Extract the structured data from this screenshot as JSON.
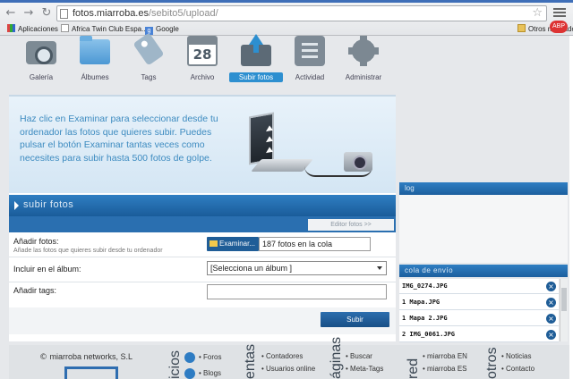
{
  "browser": {
    "url_host": "fotos.miarroba.es",
    "url_path": "/sebito5/upload/",
    "bookmarks": [
      "Aplicaciones",
      "Africa Twin Club Espa...",
      "Google"
    ],
    "other_bookmarks": "Otros marcadores",
    "badge": "ABP"
  },
  "nav": {
    "items": [
      {
        "label": "Galería",
        "icon": "camera-icon"
      },
      {
        "label": "Álbumes",
        "icon": "folder-icon"
      },
      {
        "label": "Tags",
        "icon": "tag-icon"
      },
      {
        "label": "Archivo",
        "icon": "calendar-icon",
        "number": "28"
      },
      {
        "label": "Subir fotos",
        "icon": "upload-icon",
        "active": true
      },
      {
        "label": "Actividad",
        "icon": "activity-icon"
      },
      {
        "label": "Administrar",
        "icon": "gear-icon"
      }
    ]
  },
  "hero": {
    "text": "Haz clic en Examinar para seleccionar desde tu ordenador las fotos que quieres subir. Puedes pulsar el botón Examinar tantas veces como necesites para subir hasta 500 fotos de golpe."
  },
  "upload": {
    "title": "subir fotos",
    "editor_link": "Editor fotos >>",
    "add_photos_label": "Añadir fotos:",
    "add_photos_hint": "Añade las fotos que quieres subir desde tu ordenador",
    "browse_button": "Examinar...",
    "queue_count": "187 fotos en la cola",
    "album_label": "Incluir en el álbum:",
    "album_select": "[Selecciona un álbum ]",
    "tags_label": "Añadir tags:",
    "tags_value": "",
    "submit": "Subir"
  },
  "log": {
    "title": "log"
  },
  "queue": {
    "title": "cola de envío",
    "items": [
      {
        "name": "IMG_0274.JPG"
      },
      {
        "name": "1 Mapa.JPG"
      },
      {
        "name": "1 Mapa 2.JPG"
      },
      {
        "name": "2 IMG_0061.JPG"
      }
    ]
  },
  "footer": {
    "brand": "miarroba networks, S.L",
    "copyright": "©",
    "sections": [
      "icios",
      "entas",
      "áginas",
      "red",
      "otros"
    ],
    "links": {
      "col1": [
        "Foros",
        "Blogs"
      ],
      "col2": [
        "Contadores",
        "Usuarios online"
      ],
      "col3": [
        "Buscar",
        "Meta-Tags"
      ],
      "col4": [
        "miarroba EN",
        "miarroba ES"
      ],
      "col5": [
        "Noticias",
        "Contacto"
      ]
    }
  }
}
